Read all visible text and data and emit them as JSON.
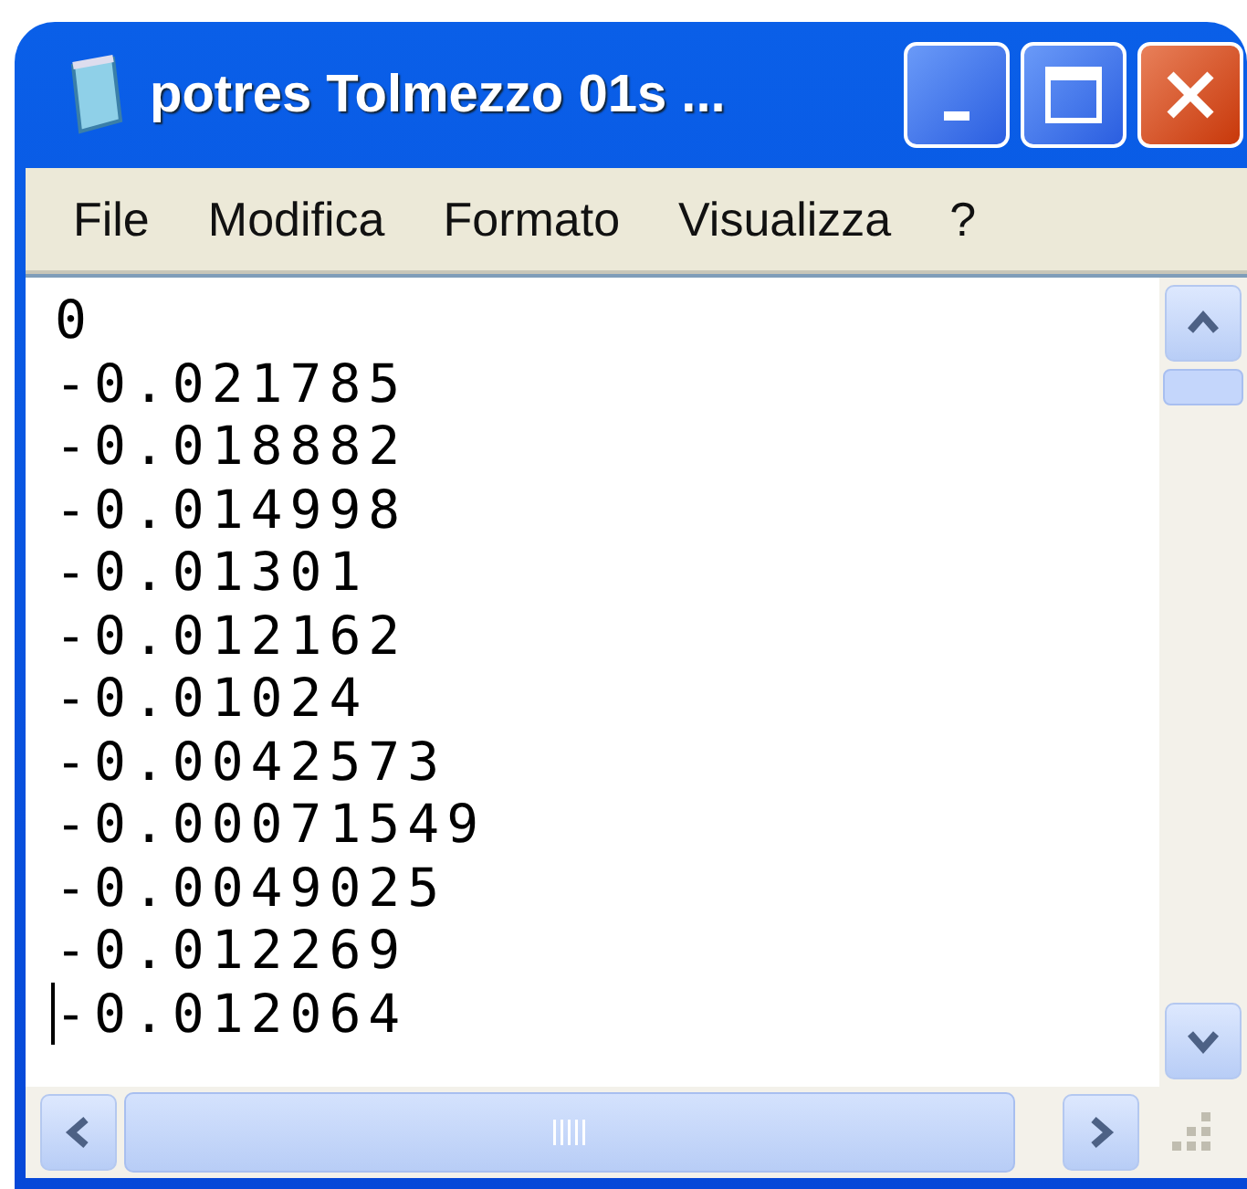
{
  "window": {
    "title": "potres Tolmezzo 01s ..."
  },
  "menu": [
    "File",
    "Modifica",
    "Formato",
    "Visualizza",
    "?"
  ],
  "lines": [
    {
      "text": "0",
      "caret": false
    },
    {
      "text": "-0.021785",
      "caret": false
    },
    {
      "text": "-0.018882",
      "caret": false
    },
    {
      "text": "-0.014998",
      "caret": false
    },
    {
      "text": "-0.01301",
      "caret": false
    },
    {
      "text": "-0.012162",
      "caret": false
    },
    {
      "text": "-0.01024",
      "caret": false
    },
    {
      "text": "-0.0042573",
      "caret": false
    },
    {
      "text": "-0.00071549",
      "caret": false
    },
    {
      "text": "-0.0049025",
      "caret": false
    },
    {
      "text": "-0.012269",
      "caret": false
    },
    {
      "text": "-0.012064",
      "caret": true
    }
  ]
}
